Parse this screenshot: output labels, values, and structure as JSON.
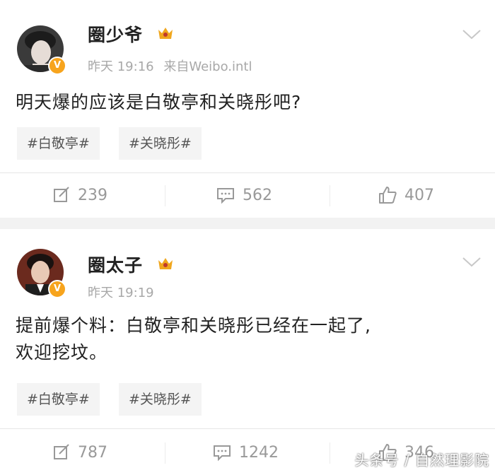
{
  "posts": [
    {
      "username": "圈少爷",
      "time": "昨天 19:16",
      "source": "来自Weibo.intl",
      "text": "明天爆的应该是白敬亭和关晓彤吧?",
      "tags": [
        "#白敬亭#",
        "#关晓彤#"
      ],
      "reposts": "239",
      "comments": "562",
      "likes": "407"
    },
    {
      "username": "圈太子",
      "time": "昨天 19:19",
      "text_line1": "提前爆个料：白敬亭和关晓彤已经在一起了,",
      "text_line2": "欢迎挖坟。",
      "tags": [
        "#白敬亭#",
        "#关晓彤#"
      ],
      "reposts": "787",
      "comments": "1242",
      "likes": "346"
    }
  ],
  "watermark": "头条号 / 自然理影院",
  "colors": {
    "badge": "#f7a41d",
    "crown": "#f0a71e",
    "meta": "#a8a8a8",
    "background": "#f2f2f2"
  },
  "icons": [
    "avatar",
    "verified-badge-icon",
    "crown-icon",
    "chevron-down-icon",
    "repost-icon",
    "comment-icon",
    "like-icon"
  ]
}
